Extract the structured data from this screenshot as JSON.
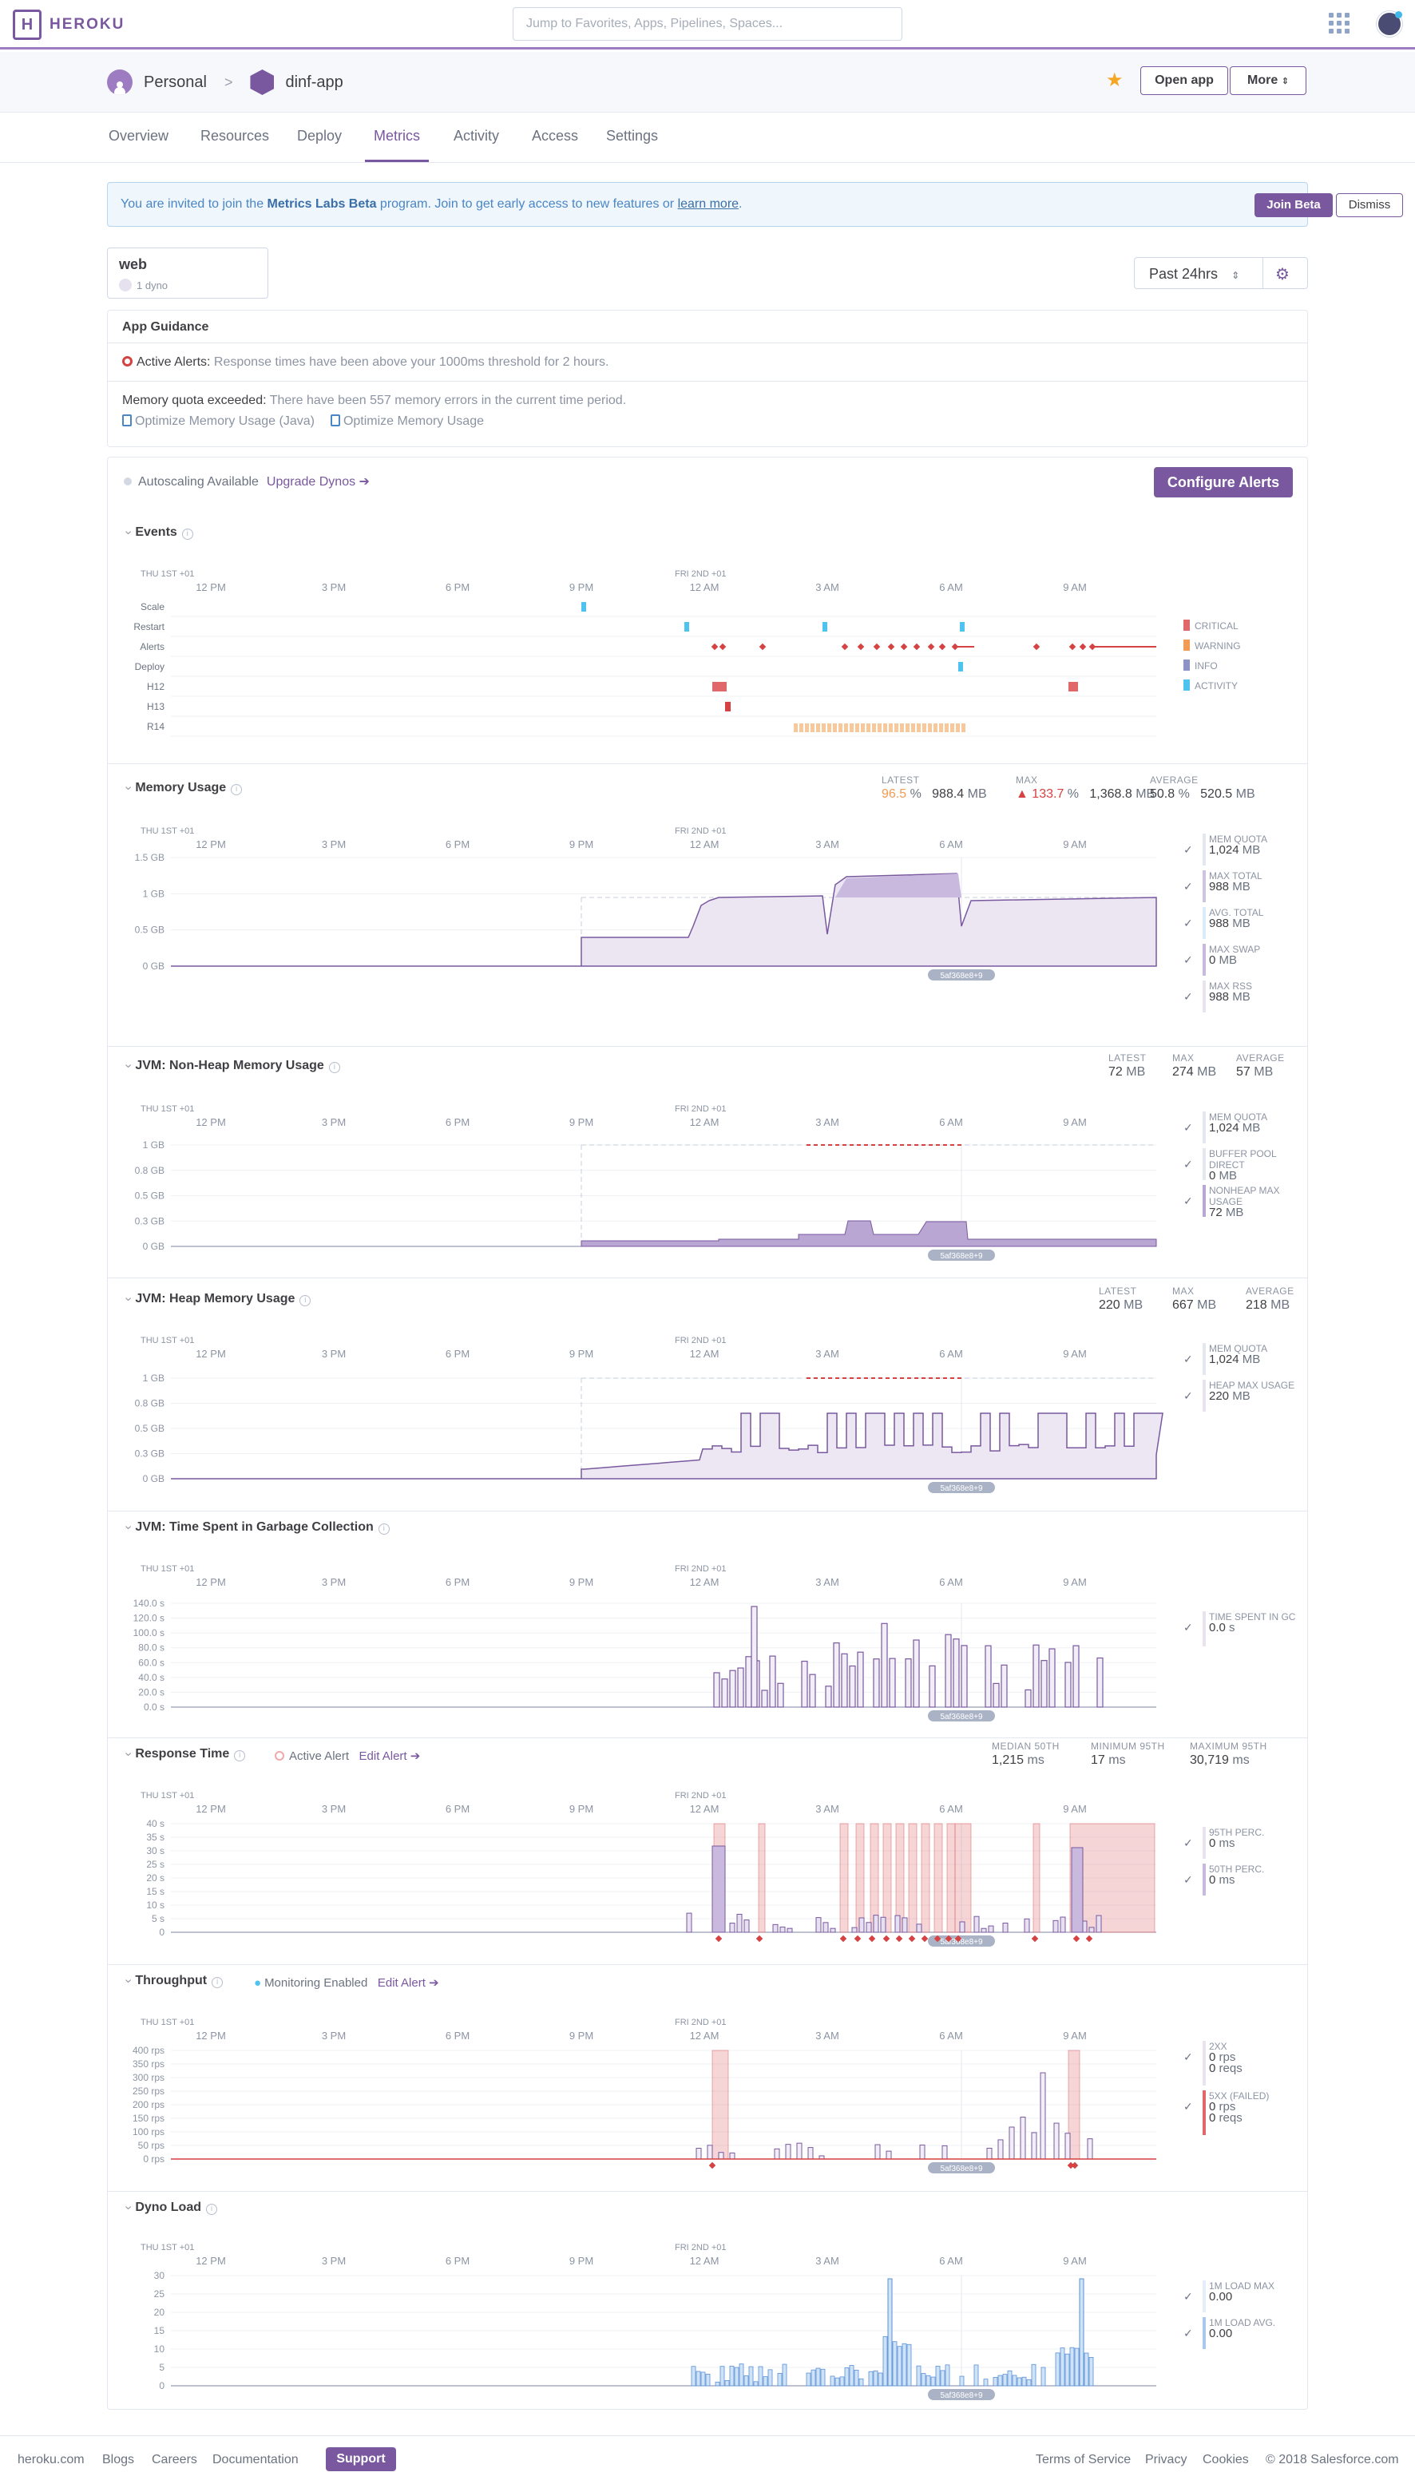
{
  "nav": {
    "logo": "HEROKU",
    "search_placeholder": "Jump to Favorites, Apps, Pipelines, Spaces..."
  },
  "header": {
    "owner": "Personal",
    "app": "dinf-app",
    "open_app": "Open app",
    "more": "More"
  },
  "tabs": [
    {
      "label": "Overview"
    },
    {
      "label": "Resources"
    },
    {
      "label": "Deploy"
    },
    {
      "label": "Metrics",
      "active": true
    },
    {
      "label": "Activity"
    },
    {
      "label": "Access"
    },
    {
      "label": "Settings"
    }
  ],
  "banner": {
    "prefix": "You are invited to join the ",
    "bold": "Metrics Labs Beta",
    "middle": " program. Join to get early access to new features or ",
    "link": "learn more",
    "suffix": ".",
    "join": "Join Beta",
    "dismiss": "Dismiss"
  },
  "dyno": {
    "name": "web",
    "count": "1 dyno"
  },
  "time_range": "Past 24hrs",
  "guidance": {
    "title": "App Guidance",
    "alert_label": "Active Alerts:",
    "alert_text": " Response times have been above your 1000ms threshold for 2 hours.",
    "memory_label": "Memory quota exceeded:",
    "memory_text": " There have been 557 memory errors in the current time period.",
    "link1": "Optimize Memory Usage (Java)",
    "link2": "Optimize Memory Usage"
  },
  "autoscaling": {
    "text": "Autoscaling Available",
    "link": "Upgrade Dynos",
    "configure": "Configure Alerts"
  },
  "timeline": {
    "day1": "THU 1ST +01",
    "day2": "FRI 2ND +01",
    "ticks": [
      "12 PM",
      "3 PM",
      "6 PM",
      "9 PM",
      "12 AM",
      "3 AM",
      "6 AM",
      "9 AM"
    ],
    "release": "5af368e8+9"
  },
  "colors": {
    "accent": "#79589f",
    "critical": "#e0686a",
    "warning": "#f59a51",
    "info": "#8c94c6",
    "activity": "#4fc3ef",
    "fill": "#d9cfe8",
    "line": "#79589f"
  },
  "sections": {
    "events": {
      "title": "Events",
      "rows": [
        "Scale",
        "Restart",
        "Alerts",
        "Deploy",
        "H12",
        "H13",
        "R14"
      ],
      "legend": [
        "CRITICAL",
        "WARNING",
        "INFO",
        "ACTIVITY"
      ]
    },
    "memory": {
      "title": "Memory Usage",
      "stats": [
        {
          "label": "LATEST",
          "pct": "96.5",
          "unit_pct": "%",
          "val": "988.4",
          "unit": "MB"
        },
        {
          "label": "MAX",
          "pct": "133.7",
          "unit_pct": "%",
          "val": "1,368.8",
          "unit": "MB"
        },
        {
          "label": "AVERAGE",
          "pct": "50.8",
          "unit_pct": "%",
          "val": "520.5",
          "unit": "MB"
        }
      ],
      "y_labels": [
        "1.5 GB",
        "1 GB",
        "0.5 GB",
        "0 GB"
      ],
      "legend": [
        {
          "label": "MEM QUOTA",
          "value": "1,024",
          "unit": "MB"
        },
        {
          "label": "MAX TOTAL",
          "value": "988",
          "unit": "MB"
        },
        {
          "label": "AVG. TOTAL",
          "value": "988",
          "unit": "MB"
        },
        {
          "label": "MAX SWAP",
          "value": "0",
          "unit": "MB"
        },
        {
          "label": "MAX RSS",
          "value": "988",
          "unit": "MB"
        }
      ]
    },
    "nonheap": {
      "title": "JVM: Non-Heap Memory Usage",
      "stats": [
        {
          "label": "LATEST",
          "val": "72",
          "unit": "MB"
        },
        {
          "label": "MAX",
          "val": "274",
          "unit": "MB"
        },
        {
          "label": "AVERAGE",
          "val": "57",
          "unit": "MB"
        }
      ],
      "y_labels": [
        "1 GB",
        "0.8 GB",
        "0.5 GB",
        "0.3 GB",
        "0 GB"
      ],
      "legend": [
        {
          "label": "MEM QUOTA",
          "value": "1,024",
          "unit": "MB"
        },
        {
          "label": "BUFFER POOL DIRECT",
          "value": "0",
          "unit": "MB"
        },
        {
          "label": "NONHEAP MAX USAGE",
          "value": "72",
          "unit": "MB"
        }
      ]
    },
    "heap": {
      "title": "JVM: Heap Memory Usage",
      "stats": [
        {
          "label": "LATEST",
          "val": "220",
          "unit": "MB"
        },
        {
          "label": "MAX",
          "val": "667",
          "unit": "MB"
        },
        {
          "label": "AVERAGE",
          "val": "218",
          "unit": "MB"
        }
      ],
      "y_labels": [
        "1 GB",
        "0.8 GB",
        "0.5 GB",
        "0.3 GB",
        "0 GB"
      ],
      "legend": [
        {
          "label": "MEM QUOTA",
          "value": "1,024",
          "unit": "MB"
        },
        {
          "label": "HEAP MAX USAGE",
          "value": "220",
          "unit": "MB"
        }
      ]
    },
    "gc": {
      "title": "JVM: Time Spent in Garbage Collection",
      "y_labels": [
        "140.0 s",
        "120.0 s",
        "100.0 s",
        "80.0 s",
        "60.0 s",
        "40.0 s",
        "20.0 s",
        "0.0 s"
      ],
      "legend": [
        {
          "label": "TIME SPENT IN GC",
          "value": "0.0",
          "unit": "s"
        }
      ]
    },
    "response": {
      "title": "Response Time",
      "alert": "Active Alert",
      "edit": "Edit Alert",
      "stats": [
        {
          "label": "MEDIAN 50TH",
          "val": "1,215",
          "unit": "ms"
        },
        {
          "label": "MINIMUM 95TH",
          "val": "17",
          "unit": "ms"
        },
        {
          "label": "MAXIMUM 95TH",
          "val": "30,719",
          "unit": "ms"
        }
      ],
      "y_labels": [
        "40 s",
        "35 s",
        "30 s",
        "25 s",
        "20 s",
        "15 s",
        "10 s",
        "5 s",
        "0"
      ],
      "legend": [
        {
          "label": "95TH PERC.",
          "value": "0",
          "unit": "ms"
        },
        {
          "label": "50TH PERC.",
          "value": "0",
          "unit": "ms"
        }
      ]
    },
    "throughput": {
      "title": "Throughput",
      "monitoring": "Monitoring Enabled",
      "edit": "Edit Alert",
      "y_labels": [
        "400 rps",
        "350 rps",
        "300 rps",
        "250 rps",
        "200 rps",
        "150 rps",
        "100 rps",
        "50 rps",
        "0 rps"
      ],
      "legend": [
        {
          "label": "2XX",
          "value": "0",
          "unit": "rps",
          "reqs": "0",
          "reqs_unit": "reqs"
        },
        {
          "label": "5XX (FAILED)",
          "value": "0",
          "unit": "rps",
          "reqs": "0",
          "reqs_unit": "reqs"
        }
      ]
    },
    "load": {
      "title": "Dyno Load",
      "y_labels": [
        "30",
        "25",
        "20",
        "15",
        "10",
        "5",
        "0"
      ],
      "legend": [
        {
          "label": "1M LOAD MAX",
          "value": "0.00"
        },
        {
          "label": "1M LOAD AVG.",
          "value": "0.00"
        }
      ]
    }
  },
  "footer": {
    "left": [
      "heroku.com",
      "Blogs",
      "Careers",
      "Documentation"
    ],
    "support": "Support",
    "right": [
      "Terms of Service",
      "Privacy",
      "Cookies",
      "© 2018 Salesforce.com"
    ]
  }
}
